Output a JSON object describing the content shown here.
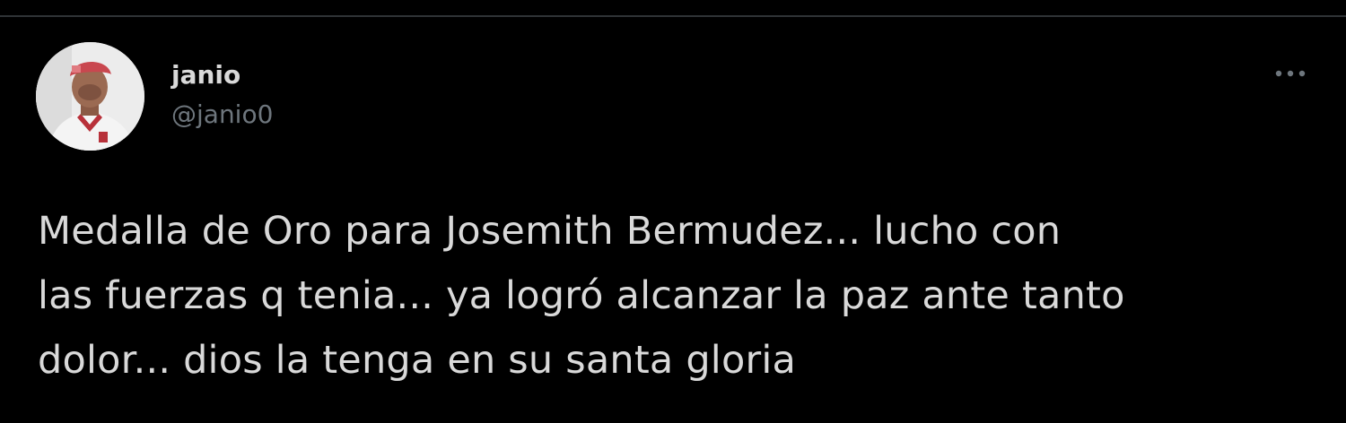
{
  "tweet": {
    "author": {
      "display_name": "janio",
      "handle": "@janio0"
    },
    "text": "Medalla de Oro para Josemith Bermudez... lucho con\nlas fuerzas q tenia... ya logró alcanzar la paz ante tanto\ndolor... dios la tenga en su santa gloria"
  },
  "icons": {
    "more": "more-horizontal-icon"
  },
  "colors": {
    "background": "#000000",
    "text_primary": "#d9d9d9",
    "text_secondary": "#6e767d",
    "divider": "#2f3336"
  }
}
